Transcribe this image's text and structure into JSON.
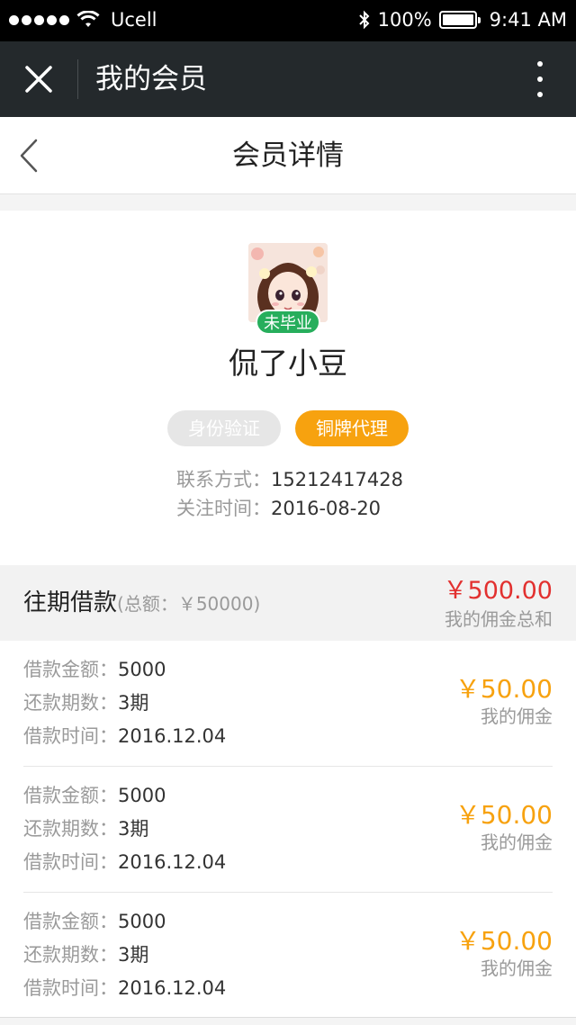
{
  "status_bar": {
    "carrier": "Ucell",
    "battery": "100%",
    "time": "9:41 AM",
    "signal_icon": "signal-dots-icon",
    "wifi_icon": "wifi-icon",
    "bluetooth_icon": "bluetooth-icon",
    "battery_icon": "battery-icon"
  },
  "app_bar": {
    "title": "我的会员",
    "close_icon": "close-icon",
    "more_icon": "more-vertical-icon",
    "background": "#24292c"
  },
  "nav": {
    "title": "会员详情",
    "back_icon": "chevron-left-icon"
  },
  "profile": {
    "badge": "未毕业",
    "name": "侃了小豆",
    "tags": [
      {
        "label": "身份验证",
        "color": "#e6e6e6"
      },
      {
        "label": "铜牌代理",
        "color": "#f7a20f"
      }
    ],
    "contact_label": "联系方式：",
    "contact_value": "15212417428",
    "follow_label": "关注时间：",
    "follow_value": "2016-08-20"
  },
  "loans_section": {
    "title": "往期借款",
    "total_text": "(总额：￥50000)",
    "commission_total": "￥500.00",
    "commission_total_label": "我的佣金总和",
    "accent_red": "#e2302f",
    "accent_orange": "#f7a20f"
  },
  "loans": [
    {
      "amount_label": "借款金额：",
      "amount": "5000",
      "periods_label": "还款期数：",
      "periods": "3期",
      "time_label": "借款时间：",
      "time": "2016.12.04",
      "commission": "￥50.00",
      "commission_label": "我的佣金"
    },
    {
      "amount_label": "借款金额：",
      "amount": "5000",
      "periods_label": "还款期数：",
      "periods": "3期",
      "time_label": "借款时间：",
      "time": "2016.12.04",
      "commission": "￥50.00",
      "commission_label": "我的佣金"
    },
    {
      "amount_label": "借款金额：",
      "amount": "5000",
      "periods_label": "还款期数：",
      "periods": "3期",
      "time_label": "借款时间：",
      "time": "2016.12.04",
      "commission": "￥50.00",
      "commission_label": "我的佣金"
    }
  ]
}
